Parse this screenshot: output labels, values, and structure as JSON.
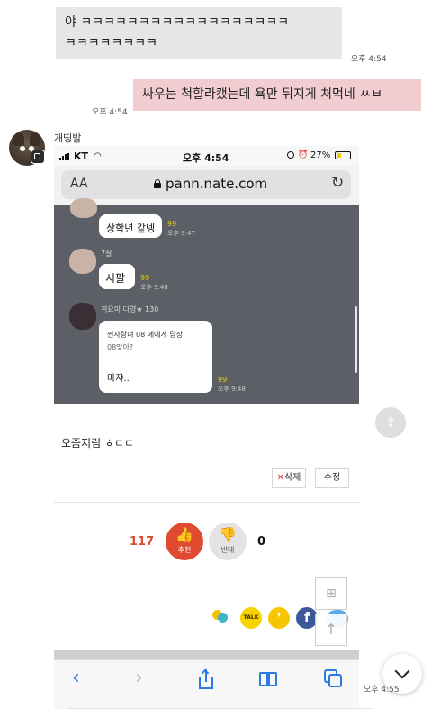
{
  "messages": {
    "first": {
      "line1": "야 ㅋㅋㅋㅋㅋㅋㅋㅋㅋㅋㅋㅋㅋㅋㅋㅋㅋㅋ",
      "line2": "ㅋㅋㅋㅋㅋㅋㅋㅋ",
      "time": "오후 4:54"
    },
    "second": {
      "text": "싸우는 척할라캤는데 욕만 뒤지게 처먹네 ㅆㅂ",
      "time": "오후 4:54"
    },
    "sender_name": "개띵발",
    "last_time": "오후 4:55"
  },
  "phone": {
    "status": {
      "carrier": "KT",
      "time": "오후 4:54",
      "battery": "27%"
    },
    "browser": {
      "aa": "AA",
      "url": "pann.nate.com"
    },
    "chat": {
      "m1": {
        "text": "상학년 같넹",
        "count": "99",
        "time": "오후 9:47"
      },
      "m2": {
        "sender": "7살",
        "text": "시팔",
        "count": "99",
        "time": "오후 9:48"
      },
      "m3": {
        "sender": "귀요미 다영★ 130",
        "quote": "찐사랑녀 08 에에게 답장",
        "quote_sub": "08맞아?",
        "text": "마쟈..",
        "count": "99",
        "time": "오후 9:48"
      }
    },
    "post": {
      "text": "오줌지림 ㅎㄷㄷ",
      "delete_label": "삭제",
      "edit_label": "수정",
      "like_count": "117",
      "like_label": "추천",
      "dislike_label": "반대",
      "dislike_count": "0",
      "talk_label": "TALK"
    }
  },
  "colors": {
    "pink_bubble": "#f1cdd2",
    "gray_bubble": "#e6e6e6",
    "like_red": "#e04a2f",
    "kakao_yellow": "#f7d300"
  }
}
